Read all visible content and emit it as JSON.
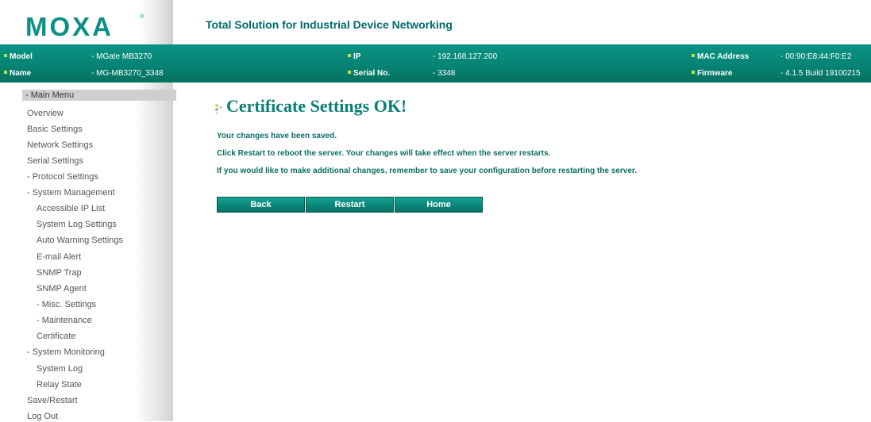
{
  "header": {
    "logo_text": "MOXA",
    "logo_reg": "®",
    "tagline": "Total Solution for Industrial Device Networking"
  },
  "device_info": {
    "model_label": "Model",
    "model_value": "- MGate MB3270",
    "name_label": "Name",
    "name_value": "- MG-MB3270_3348",
    "ip_label": "IP",
    "ip_value": "- 192.168.127.200",
    "serial_label": "Serial No.",
    "serial_value": "- 3348",
    "mac_label": "MAC Address",
    "mac_value": "- 00:90:E8:44:F0:E2",
    "firmware_label": "Firmware",
    "firmware_value": "- 4.1.5 Build 19100215"
  },
  "sidebar": {
    "title": "- Main Menu",
    "items": [
      "Overview",
      "Basic Settings",
      "Network Settings",
      "Serial Settings",
      "- Protocol Settings",
      "- System Management",
      "Accessible IP List",
      "System Log Settings",
      "Auto Warning Settings",
      "E-mail Alert",
      "SNMP Trap",
      "SNMP Agent",
      "- Misc. Settings",
      "- Maintenance",
      "Certificate",
      "- System Monitoring",
      "System Log",
      "Relay State",
      "Save/Restart",
      "Log Out"
    ]
  },
  "main": {
    "title": "Certificate Settings OK!",
    "messages": [
      "Your changes have been saved.",
      "Click Restart to reboot the server. Your changes will take effect when the server restarts.",
      "If you would like to make additional changes, remember to save your configuration before restarting the server."
    ],
    "buttons": {
      "back": "Back",
      "restart": "Restart",
      "home": "Home"
    }
  },
  "colors": {
    "brand": "#0d8f86",
    "bar": "#068272",
    "accent_square": "#c8e23a"
  }
}
